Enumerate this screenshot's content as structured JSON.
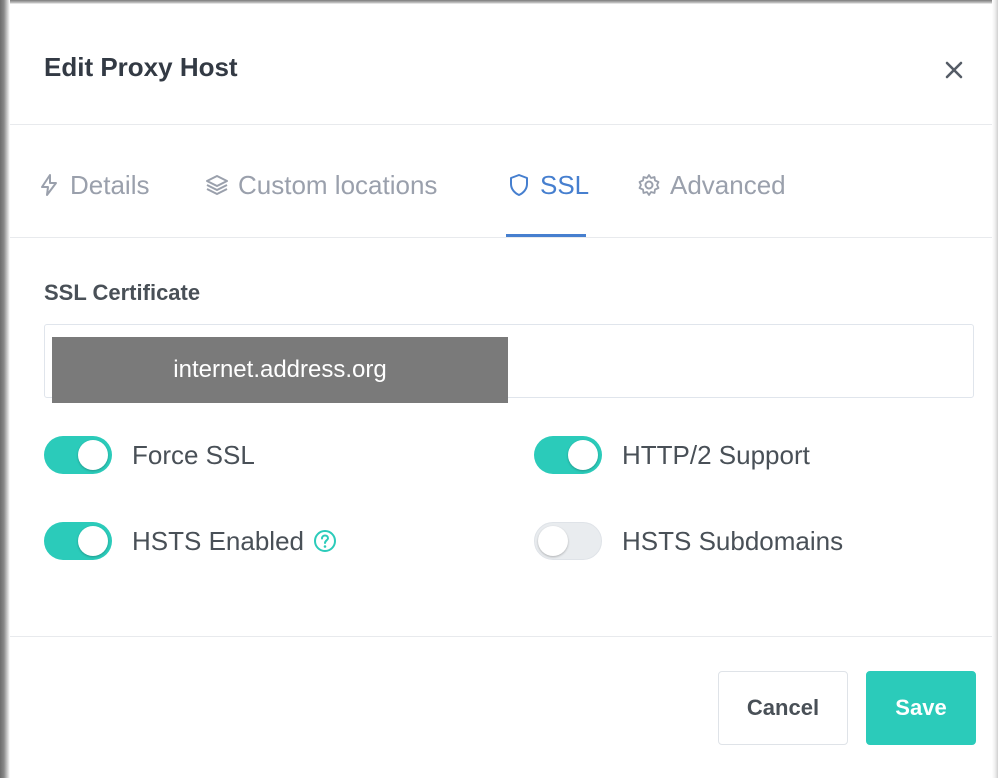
{
  "modal": {
    "title": "Edit Proxy Host",
    "close_icon": "close-icon"
  },
  "tabs": [
    {
      "label": "Details",
      "icon": "bolt-icon",
      "active": false
    },
    {
      "label": "Custom locations",
      "icon": "layers-icon",
      "active": false
    },
    {
      "label": "SSL",
      "icon": "shield-icon",
      "active": true
    },
    {
      "label": "Advanced",
      "icon": "gear-icon",
      "active": false
    }
  ],
  "ssl": {
    "certificate_label": "SSL Certificate",
    "certificate_value": "internet.address.org",
    "toggles": [
      {
        "label": "Force SSL",
        "enabled": true
      },
      {
        "label": "HTTP/2 Support",
        "enabled": true
      },
      {
        "label": "HSTS Enabled",
        "enabled": true,
        "help_icon": "question-circle-icon"
      },
      {
        "label": "HSTS Subdomains",
        "enabled": false
      }
    ]
  },
  "footer": {
    "cancel_label": "Cancel",
    "save_label": "Save"
  },
  "colors": {
    "accent": "#467fcf",
    "teal": "#2bcbba",
    "muted_text": "#9aa0ac",
    "text": "#495057"
  }
}
